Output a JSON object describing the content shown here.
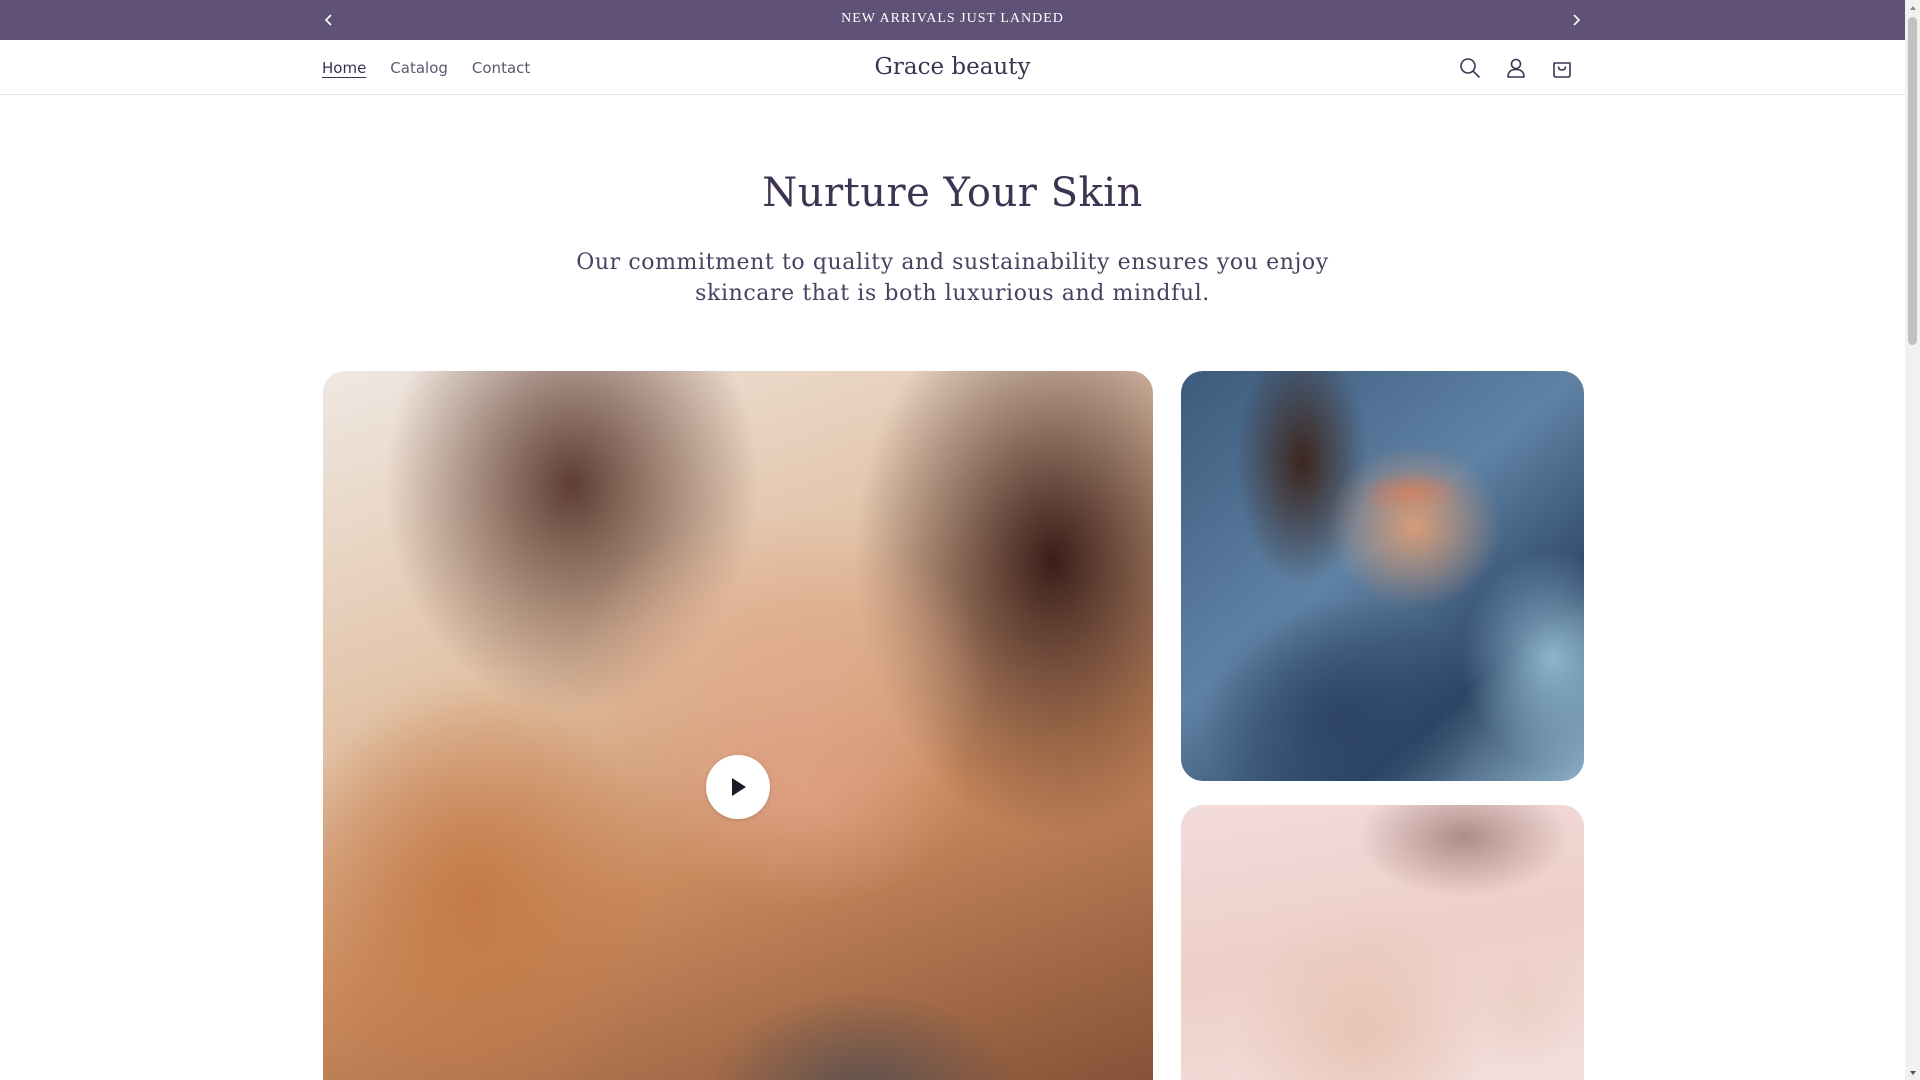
{
  "announcement": {
    "text": "NEW ARRIVALS JUST LANDED",
    "prev_icon": "chevron-left-icon",
    "next_icon": "chevron-right-icon",
    "background": "#5f5276"
  },
  "header": {
    "nav": [
      {
        "label": "Home",
        "active": true
      },
      {
        "label": "Catalog",
        "active": false
      },
      {
        "label": "Contact",
        "active": false
      }
    ],
    "logo": "Grace beauty",
    "icons": [
      "search-icon",
      "account-icon",
      "cart-icon"
    ]
  },
  "hero": {
    "title": "Nurture Your Skin",
    "subtitle": "Our commitment to quality and sustainability ensures you enjoy skincare that is both luxurious and mindful."
  },
  "media": {
    "video_tile": {
      "play_icon": "play-icon"
    },
    "photos": [
      "model-denim-jacket-photo",
      "model-smiling-photo"
    ]
  },
  "colors": {
    "accent": "#5f5276",
    "heading": "#3e3452",
    "body_text": "#4a4060"
  }
}
